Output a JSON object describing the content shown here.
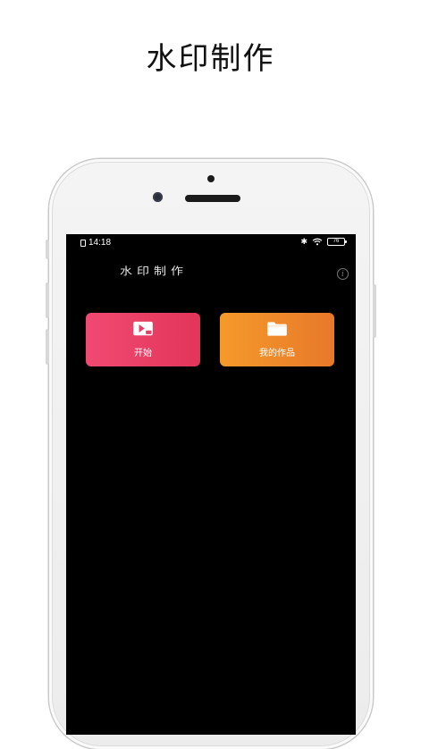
{
  "promo": {
    "title": "水印制作"
  },
  "status_bar": {
    "time": "14:18",
    "battery": "76"
  },
  "app": {
    "title": "水印制作",
    "info_icon": "i"
  },
  "buttons": {
    "start": {
      "label": "开始",
      "icon": "video-icon"
    },
    "my_works": {
      "label": "我的作品",
      "icon": "folder-icon"
    }
  },
  "colors": {
    "start_tile": "#e93d64",
    "works_tile": "#ef8a2a",
    "screen_bg": "#000000"
  }
}
